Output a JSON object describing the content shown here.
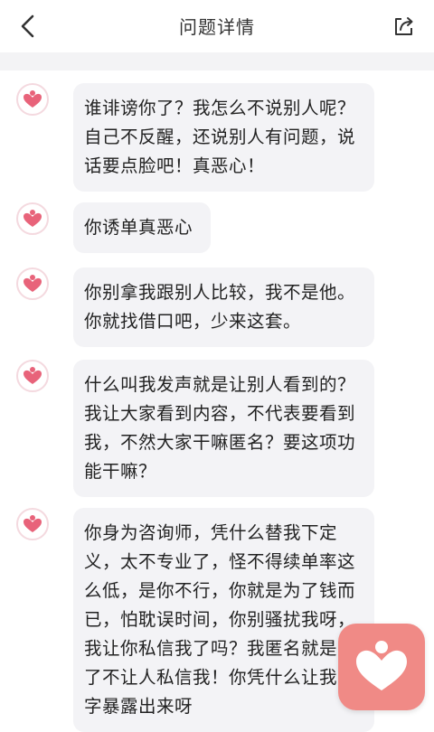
{
  "header": {
    "title": "问题详情",
    "back_icon": "chevron-left-icon",
    "share_icon": "share-icon"
  },
  "messages": [
    {
      "text": "谁诽谤你了？我怎么不说别人呢？自己不反醒，还说别人有问题，说话要点脸吧！真恶心！"
    },
    {
      "text": "你诱单真恶心"
    },
    {
      "text": "你别拿我跟别人比较，我不是他。你就找借口吧，少来这套。"
    },
    {
      "text": "什么叫我发声就是让别人看到的？我让大家看到内容，不代表要看到我，不然大家干嘛匿名？要这项功能干嘛？"
    },
    {
      "text": "你身为咨询师，凭什么替我下定义，太不专业了，怪不得续单率这么低，是你不行，你就是为了钱而已，怕耽误时间，你别骚扰我呀，我让你私信我了吗？我匿名就是为了不让人私信我！你凭什么让我名字暴露出来呀"
    }
  ],
  "colors": {
    "accent": "#e8637a",
    "float_app_bg": "#f08a86",
    "bubble_bg": "#f3f3f6"
  }
}
